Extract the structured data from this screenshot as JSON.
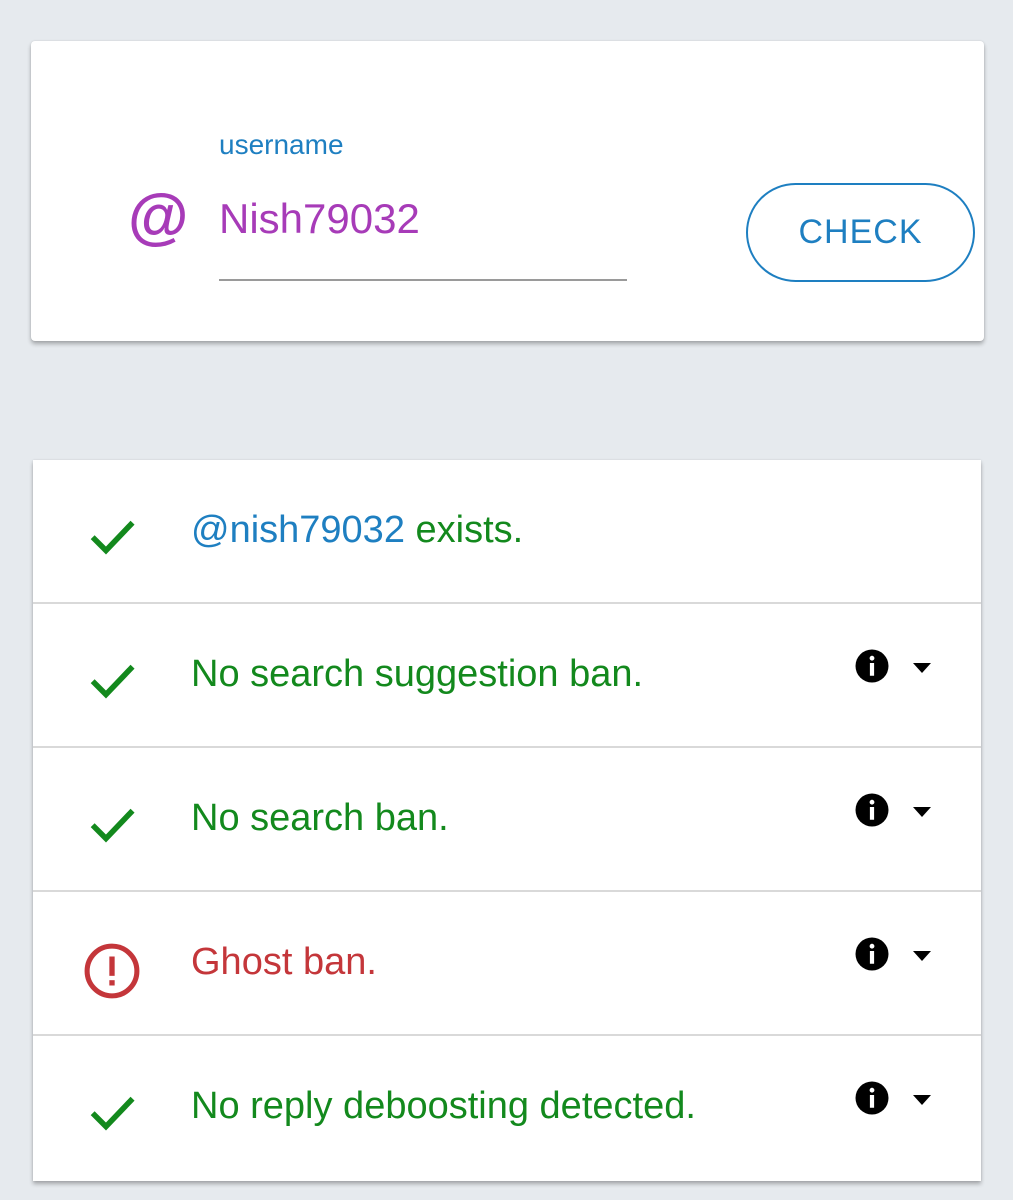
{
  "search": {
    "label": "username",
    "value": "Nish79032",
    "at_symbol": "@",
    "button_label": "CHECK"
  },
  "results": [
    {
      "status": "ok",
      "icon": "check-icon",
      "handle": "@nish79032",
      "text": " exists.",
      "has_info": false
    },
    {
      "status": "ok",
      "icon": "check-icon",
      "handle": "",
      "text": "No search suggestion ban.",
      "has_info": true
    },
    {
      "status": "ok",
      "icon": "check-icon",
      "handle": "",
      "text": "No search ban.",
      "has_info": true
    },
    {
      "status": "error",
      "icon": "alert-circle-icon",
      "handle": "",
      "text": "Ghost ban.",
      "has_info": true
    },
    {
      "status": "ok",
      "icon": "check-icon",
      "handle": "",
      "text": "No reply deboosting detected.",
      "has_info": true
    }
  ],
  "colors": {
    "ok": "#13891d",
    "error": "#c4363a",
    "link": "#1e7fc1",
    "accent": "#a73bb8"
  }
}
